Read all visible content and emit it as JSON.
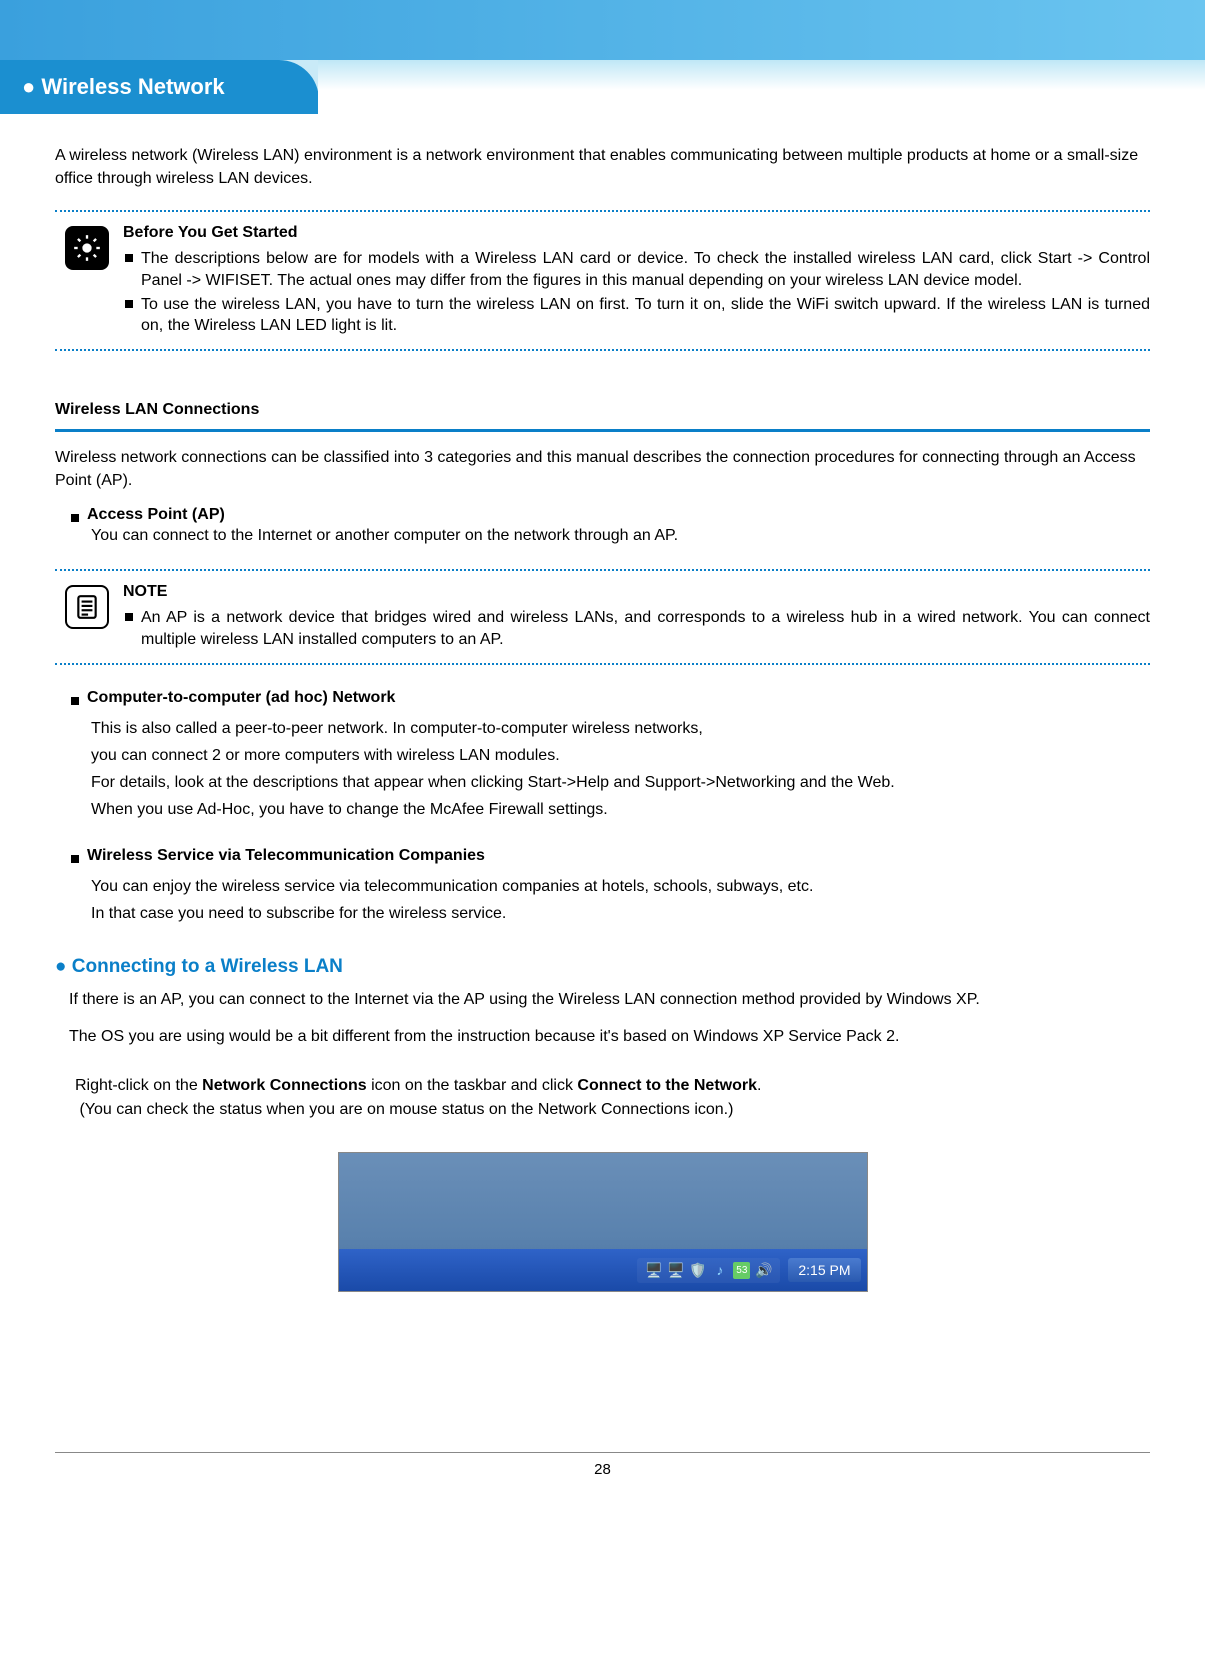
{
  "header": {
    "bullet": "●",
    "title": "Wireless Network"
  },
  "intro": "A wireless network (Wireless LAN) environment is a network environment that enables communicating between multiple products at home or a small-size office through wireless LAN devices.",
  "before": {
    "title": "Before You Get Started",
    "bullets": [
      "The descriptions below are for models with a Wireless LAN card or device. To check the installed wireless LAN card, click Start -> Control Panel -> WIFISET. The actual ones may differ from the figures in this manual depending on your wireless LAN device model.",
      "To use the wireless LAN, you have to turn the wireless LAN on first. To turn it on, slide the WiFi switch upward. If the wireless LAN is turned on, the Wireless LAN LED light is lit."
    ]
  },
  "section1": {
    "title": "Wireless LAN Connections",
    "intro": "Wireless network connections can be classified into 3 categories and this manual describes the connection procedures for connecting through an Access Point (AP).",
    "ap_title": "Access Point (AP)",
    "ap_body": "You can connect to the Internet or another computer on the network through an AP."
  },
  "note": {
    "title": "NOTE",
    "body": "An AP is a network device that bridges wired and wireless LANs, and corresponds to a wireless hub in a wired network. You can connect multiple wireless LAN installed computers to an AP."
  },
  "adhoc": {
    "title": "Computer-to-computer (ad hoc) Network",
    "l1": "This is also called a peer-to-peer network. In computer-to-computer wireless networks,",
    "l2": "you can connect 2 or more computers with wireless LAN modules.",
    "l3": "For details, look at the descriptions that appear when clicking Start->Help and Support->Networking and the Web.",
    "l4": "When you use Ad-Hoc, you have to change the McAfee Firewall settings."
  },
  "telecom": {
    "title": "Wireless Service via Telecommunication Companies",
    "l1": "You can enjoy the wireless service via telecommunication companies at hotels, schools, subways, etc.",
    "l2": "In that case you need to subscribe for the wireless service."
  },
  "connecting": {
    "heading_bullet": "●",
    "heading": "Connecting to a Wireless LAN",
    "p1": "If there is an AP, you can connect to the Internet via the AP using the Wireless LAN connection method provided by Windows XP.",
    "p2": "The OS you are using would be a bit different from the instruction because it's based on Windows XP Service Pack 2.",
    "step_a": "Right-click on the ",
    "step_b_bold": "Network Connections",
    "step_c": " icon on the taskbar and click ",
    "step_d_bold": "Connect to the Network",
    "step_e": ".",
    "step_sub": "(You can check the status when you are on mouse status on the Network Connections icon.)"
  },
  "taskbar": {
    "clock": "2:15 PM"
  },
  "page_number": "28"
}
